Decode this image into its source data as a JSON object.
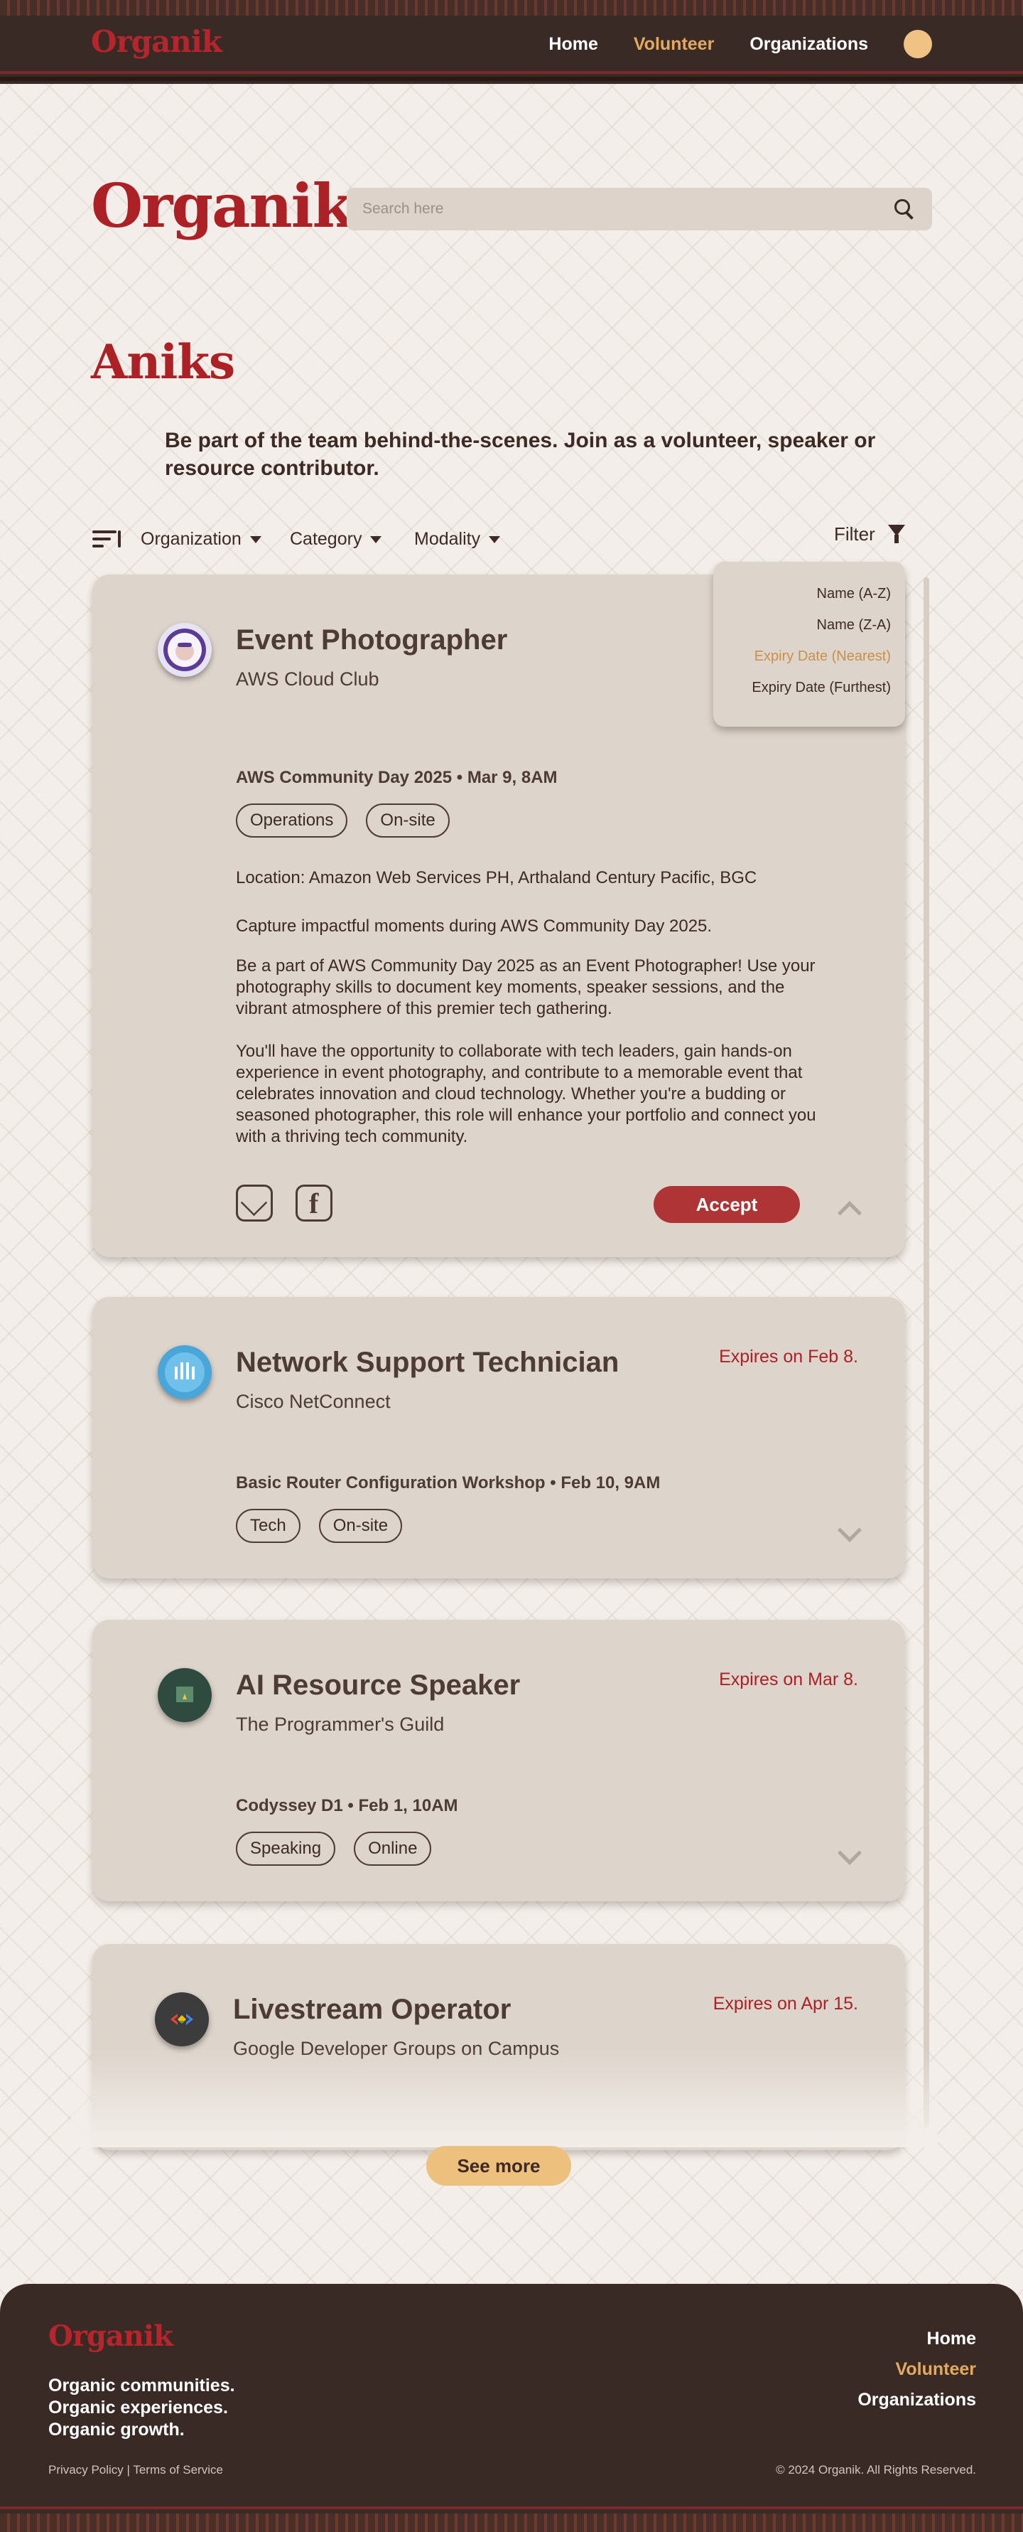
{
  "nav": {
    "logo": "Organik",
    "links": [
      "Home",
      "Volunteer",
      "Organizations"
    ],
    "active": "Volunteer"
  },
  "header": {
    "logo": "Organik",
    "search_placeholder": "Search here"
  },
  "page": {
    "title": "Aniks",
    "intro": "Be part of the team behind-the-scenes. Join as a volunteer, speaker or resource contributor."
  },
  "filters": {
    "dropdowns": [
      "Organization",
      "Category",
      "Modality"
    ],
    "filter_label": "Filter"
  },
  "sort_menu": {
    "options": [
      "Name (A-Z)",
      "Name (Z-A)",
      "Expiry Date (Nearest)",
      "Expiry Date (Furthest)"
    ],
    "active": "Expiry Date (Nearest)"
  },
  "cards": [
    {
      "title": "Event Photographer",
      "org": "AWS Cloud Club",
      "event": "AWS Community Day 2025  •  Mar 9, 8AM",
      "tags": [
        "Operations",
        "On-site"
      ],
      "location": "Location: Amazon Web Services PH, Arthaland Century Pacific, BGC",
      "summary": "Capture impactful moments during AWS Community Day 2025.",
      "para1": "Be a part of AWS Community Day 2025 as an Event Photographer! Use your photography skills to document key moments, speaker sessions, and the vibrant atmosphere of this premier tech gathering.",
      "para2": "You'll have the opportunity to collaborate with tech leaders, gain hands-on experience in event photography, and contribute to a memorable event that celebrates innovation and cloud technology. Whether you're a budding or seasoned photographer, this role will enhance your portfolio and connect you with a thriving tech community.",
      "accept": "Accept"
    },
    {
      "title": "Network Support Technician",
      "org": "Cisco NetConnect",
      "expiry": "Expires on Feb 8.",
      "event": "Basic Router Configuration Workshop  •  Feb 10, 9AM",
      "tags": [
        "Tech",
        "On-site"
      ]
    },
    {
      "title": "AI Resource Speaker",
      "org": "The Programmer's Guild",
      "expiry": "Expires on Mar 8.",
      "event": "Codyssey D1  •  Feb 1, 10AM",
      "tags": [
        "Speaking",
        "Online"
      ]
    },
    {
      "title": "Livestream Operator",
      "org": "Google Developer Groups on Campus",
      "expiry": "Expires on Apr 15."
    }
  ],
  "see_more": "See more",
  "footer": {
    "logo": "Organik",
    "tagline": [
      "Organic communities.",
      "Organic experiences.",
      "Organic growth."
    ],
    "links": [
      "Home",
      "Volunteer",
      "Organizations"
    ],
    "legal": "Privacy Policy | Terms of Service",
    "copyright": "© 2024 Organik. All Rights Reserved."
  },
  "colors": {
    "accent_red": "#ab2126",
    "accent_gold": "#e2a95f",
    "dark_brown": "#3a2a26",
    "card_bg": "#ddd4cb"
  }
}
